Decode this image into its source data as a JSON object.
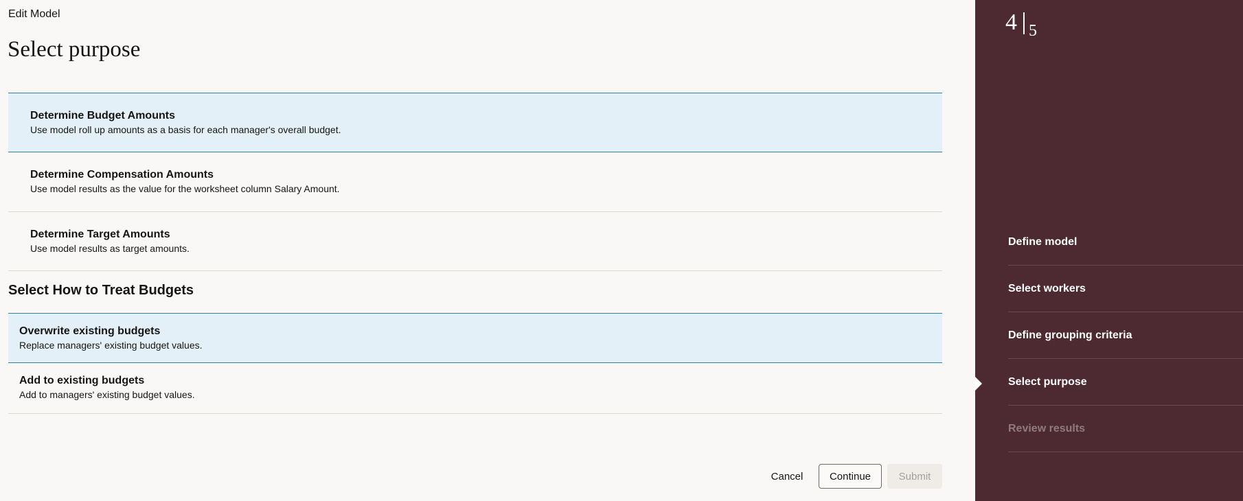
{
  "header": {
    "breadcrumb": "Edit Model",
    "title": "Select purpose"
  },
  "purpose_options": [
    {
      "title": "Determine Budget Amounts",
      "description": "Use model roll up amounts as a basis for each manager's overall budget.",
      "selected": true
    },
    {
      "title": "Determine Compensation Amounts",
      "description": "Use model results as the value for the worksheet column Salary Amount.",
      "selected": false
    },
    {
      "title": "Determine Target Amounts",
      "description": "Use model results as target amounts.",
      "selected": false
    }
  ],
  "budget_section": {
    "title": "Select How to Treat Budgets",
    "options": [
      {
        "title": "Overwrite existing budgets",
        "description": "Replace managers' existing budget values.",
        "selected": true
      },
      {
        "title": "Add to existing budgets",
        "description": "Add to managers' existing budget values.",
        "selected": false
      }
    ]
  },
  "actions": {
    "cancel": "Cancel",
    "continue": "Continue",
    "submit": "Submit"
  },
  "sidebar": {
    "current_step": "4",
    "total_steps": "5",
    "steps": [
      {
        "label": "Define model",
        "state": "done"
      },
      {
        "label": "Select workers",
        "state": "done"
      },
      {
        "label": "Define grouping criteria",
        "state": "done"
      },
      {
        "label": "Select purpose",
        "state": "current"
      },
      {
        "label": "Review results",
        "state": "disabled"
      }
    ]
  },
  "colors": {
    "sidebar_bg": "#4d2a31",
    "selected_bg": "#e4f0f7",
    "selected_border": "#2f7fa3",
    "page_bg": "#f9f8f6"
  }
}
